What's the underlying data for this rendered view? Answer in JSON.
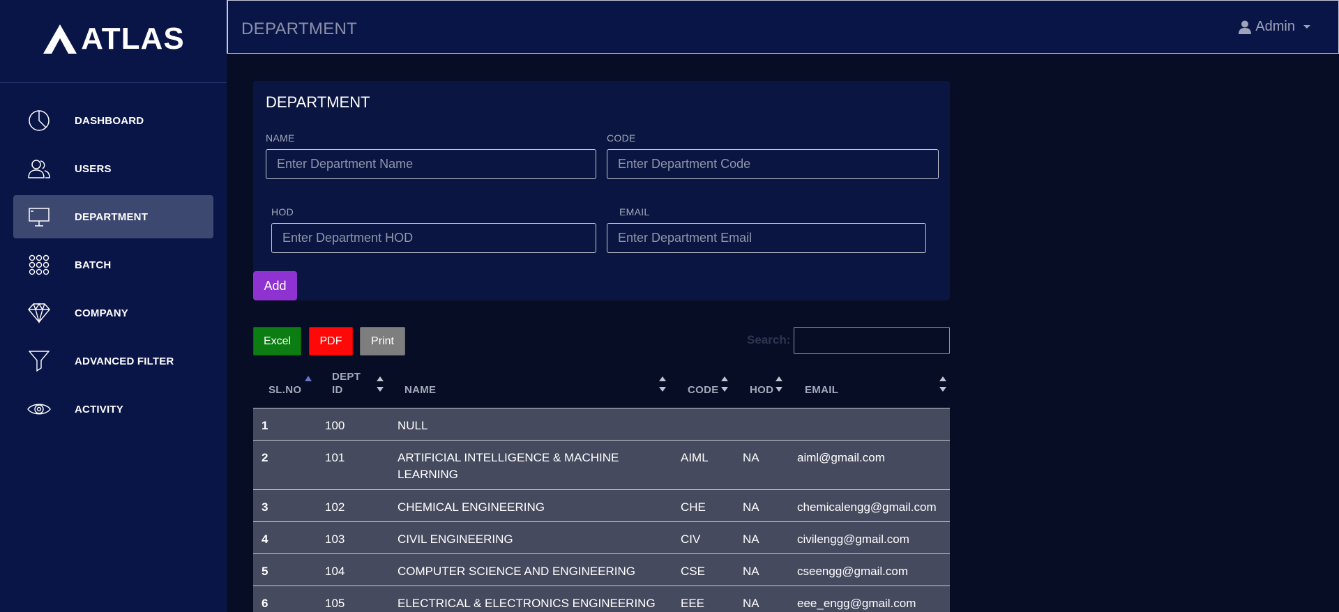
{
  "brand": {
    "name": "ATLAS"
  },
  "sidebar": {
    "items": [
      {
        "label": "DASHBOARD",
        "icon": "pie-chart-icon"
      },
      {
        "label": "USERS",
        "icon": "users-icon"
      },
      {
        "label": "DEPARTMENT",
        "icon": "presentation-icon",
        "active": true
      },
      {
        "label": "BATCH",
        "icon": "grid-dots-icon"
      },
      {
        "label": "COMPANY",
        "icon": "diamond-icon"
      },
      {
        "label": "ADVANCED FILTER",
        "icon": "filter-icon"
      },
      {
        "label": "ACTIVITY",
        "icon": "eye-icon"
      }
    ]
  },
  "topbar": {
    "title": "DEPARTMENT",
    "user": "Admin",
    "user_icon": "user-icon"
  },
  "form": {
    "title": "DEPARTMENT",
    "name_label": "NAME",
    "name_placeholder": "Enter Department Name",
    "code_label": "CODE",
    "code_placeholder": "Enter Department Code",
    "hod_label": "HOD",
    "hod_placeholder": "Enter Department HOD",
    "email_label": "EMAIL",
    "email_placeholder": "Enter Department Email",
    "add_label": "Add"
  },
  "toolbar": {
    "excel": "Excel",
    "pdf": "PDF",
    "print": "Print",
    "search_label": "Search:"
  },
  "table": {
    "headers": [
      "SL.NO",
      "DEPT ID",
      "NAME",
      "CODE",
      "HOD",
      "EMAIL"
    ],
    "rows": [
      {
        "sl": "1",
        "id": "100",
        "name": "NULL",
        "code": "",
        "hod": "",
        "email": ""
      },
      {
        "sl": "2",
        "id": "101",
        "name": "ARTIFICIAL INTELLIGENCE & MACHINE LEARNING",
        "code": "AIML",
        "hod": "NA",
        "email": "aiml@gmail.com"
      },
      {
        "sl": "3",
        "id": "102",
        "name": "CHEMICAL ENGINEERING",
        "code": "CHE",
        "hod": "NA",
        "email": "chemicalengg@gmail.com"
      },
      {
        "sl": "4",
        "id": "103",
        "name": "CIVIL ENGINEERING",
        "code": "CIV",
        "hod": "NA",
        "email": "civilengg@gmail.com"
      },
      {
        "sl": "5",
        "id": "104",
        "name": "COMPUTER SCIENCE AND ENGINEERING",
        "code": "CSE",
        "hod": "NA",
        "email": "cseengg@gmail.com"
      },
      {
        "sl": "6",
        "id": "105",
        "name": "ELECTRICAL & ELECTRONICS ENGINEERING",
        "code": "EEE",
        "hod": "NA",
        "email": "eee_engg@gmail.com"
      }
    ]
  },
  "colors": {
    "sidebar_bg": "#0a1547",
    "active_item": "#3c4870",
    "add_button": "#8e32d2",
    "excel": "#0b7d12",
    "pdf": "#ff0808",
    "print": "#7e7e7e",
    "row_bg": "#454a5e"
  }
}
